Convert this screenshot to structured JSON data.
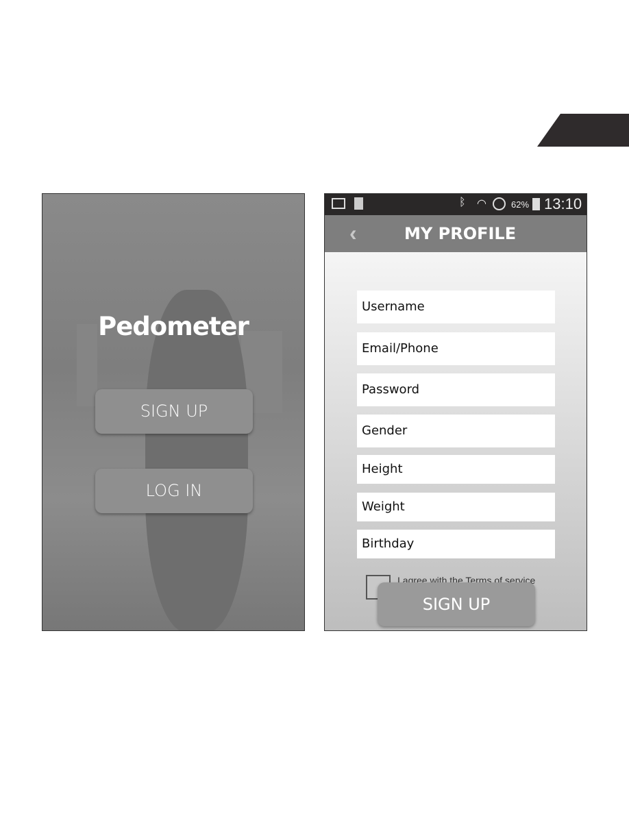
{
  "left_screen": {
    "app_title": "Pedometer",
    "signup_label": "SIGN UP",
    "login_label": "LOG IN"
  },
  "right_screen": {
    "status_bar": {
      "battery": "62%",
      "time": "13:10",
      "icons": [
        "image-icon",
        "sim-missing-icon",
        "bluetooth-icon",
        "wifi-icon",
        "do-not-disturb-icon",
        "battery-icon"
      ]
    },
    "header": {
      "title": "MY PROFILE",
      "back_icon": "chevron-left-icon"
    },
    "fields": [
      {
        "placeholder": "Username"
      },
      {
        "placeholder": "Email/Phone"
      },
      {
        "placeholder": "Password"
      },
      {
        "placeholder": "Gender"
      },
      {
        "placeholder": "Height"
      },
      {
        "placeholder": "Weight"
      },
      {
        "placeholder": "Birthday"
      }
    ],
    "agree_label": "I agree with the Terms of service",
    "signup_label": "SIGN UP"
  }
}
